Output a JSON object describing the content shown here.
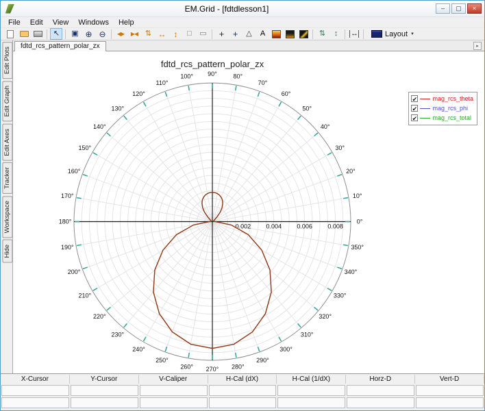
{
  "window": {
    "title": "EM.Grid - [fdtdlesson1]",
    "controls": [
      {
        "name": "minimize-button",
        "glyph": "–"
      },
      {
        "name": "maximize-button",
        "glyph": "▢"
      },
      {
        "name": "close-button",
        "glyph": "×",
        "close": true
      }
    ]
  },
  "menu": {
    "items": [
      "File",
      "Edit",
      "View",
      "Windows",
      "Help"
    ]
  },
  "toolbar": {
    "buttons": [
      {
        "type": "page",
        "name": "new-file-button"
      },
      {
        "type": "folder",
        "name": "open-file-button"
      },
      {
        "type": "printer",
        "name": "print-button"
      },
      {
        "type": "sep"
      },
      {
        "type": "glyph",
        "name": "select-cursor-button",
        "glyph": "↖",
        "color": "#222222",
        "size": 11,
        "active": true
      },
      {
        "type": "sep"
      },
      {
        "type": "glyph",
        "name": "zoom-window-button",
        "glyph": "▣",
        "color": "#1c2f6d",
        "size": 11
      },
      {
        "type": "glyph",
        "name": "zoom-in-button",
        "glyph": "⊕",
        "color": "#1c2f6d",
        "size": 12
      },
      {
        "type": "glyph",
        "name": "zoom-out-button",
        "glyph": "⊖",
        "color": "#1c2f6d",
        "size": 12
      },
      {
        "type": "sep"
      },
      {
        "type": "glyph",
        "name": "fit-width-button",
        "glyph": "◀▶",
        "color": "#d07800",
        "size": 8
      },
      {
        "type": "glyph",
        "name": "shrink-width-button",
        "glyph": "▶◀",
        "color": "#d07800",
        "size": 8
      },
      {
        "type": "glyph",
        "name": "fit-height-button",
        "glyph": "⇅",
        "color": "#d07800",
        "size": 11
      },
      {
        "type": "glyph",
        "name": "expand-horizontal-button",
        "glyph": "↔",
        "color": "#d07800",
        "size": 12
      },
      {
        "type": "glyph",
        "name": "expand-vertical-button",
        "glyph": "↕",
        "color": "#d07800",
        "size": 12
      },
      {
        "type": "glyph",
        "name": "box-select-button",
        "glyph": "□",
        "color": "#777777",
        "size": 11
      },
      {
        "type": "glyph",
        "name": "dashed-box-button",
        "glyph": "▭",
        "color": "#777777",
        "size": 11
      },
      {
        "type": "sep"
      },
      {
        "type": "glyph",
        "name": "crosshair-button",
        "glyph": "+",
        "color": "#222222",
        "size": 13
      },
      {
        "type": "glyph",
        "name": "add-cursor-button",
        "glyph": "+",
        "color": "#1c2f6d",
        "size": 13
      },
      {
        "type": "glyph",
        "name": "caliper-button",
        "glyph": "△",
        "color": "#333333",
        "size": 11
      },
      {
        "type": "glyph",
        "name": "text-tool-button",
        "glyph": "A",
        "color": "#000000",
        "size": 11
      },
      {
        "type": "grad1",
        "name": "colormap-hot-button"
      },
      {
        "type": "grad2",
        "name": "colormap-dark-button"
      },
      {
        "type": "grad3",
        "name": "colormap-contour-button"
      },
      {
        "type": "sep"
      },
      {
        "type": "glyph",
        "name": "shift-up-down-button",
        "glyph": "⇅",
        "color": "#2a7a4f",
        "size": 11
      },
      {
        "type": "glyph",
        "name": "stretch-vertical-button",
        "glyph": "↕",
        "color": "#2a7a4f",
        "size": 11
      },
      {
        "type": "sep"
      },
      {
        "type": "glyph",
        "name": "h-measure-button",
        "glyph": "↔",
        "color": "#333333",
        "size": 11,
        "bracket": true
      },
      {
        "type": "sep"
      },
      {
        "type": "layout",
        "name": "layout-button",
        "label": "Layout",
        "caret": "▼"
      }
    ]
  },
  "sidebar": {
    "tabs": [
      "Edit Plots",
      "Edit Graph",
      "Edit Axes",
      "Tracker",
      "Workspace",
      "Hide"
    ]
  },
  "tabs": {
    "active": "fdtd_rcs_pattern_polar_zx"
  },
  "legend": {
    "check_glyph": "✔",
    "items": [
      {
        "label": "mag_rcs_theta",
        "color": "#cc2020",
        "checked": true
      },
      {
        "label": "mag_rcs_phi",
        "color": "#5050cc",
        "checked": true
      },
      {
        "label": "mag_rcs_total",
        "color": "#2fa22f",
        "checked": true
      }
    ]
  },
  "status_bar": {
    "columns": [
      "X-Cursor",
      "Y-Cursor",
      "V-Caliper",
      "H-Cal (dX)",
      "H-Cal (1/dX)",
      "Horz-D",
      "Vert-D"
    ]
  },
  "chart_data": {
    "type": "polar",
    "title": "fdtd_rcs_pattern_polar_zx",
    "r_max": 0.009,
    "r_grid_step": 0.0005,
    "angle_step_deg": 10,
    "degree_suffix": "°",
    "grid_on": true,
    "grid_color": "#e4e4e4",
    "axis_color": "#1a1a1a",
    "tick_color": "#35a89b",
    "legend_position": "top-right",
    "angle_labels_deg": [
      0,
      10,
      20,
      30,
      40,
      50,
      60,
      70,
      80,
      90,
      100,
      110,
      120,
      130,
      140,
      150,
      160,
      170,
      180,
      190,
      200,
      210,
      220,
      230,
      240,
      250,
      260,
      270,
      280,
      290,
      300,
      310,
      320,
      330,
      340,
      350
    ],
    "r_tick_labels": [
      {
        "value": 0.002,
        "label": "0.002"
      },
      {
        "value": 0.004,
        "label": "0.004"
      },
      {
        "value": 0.006,
        "label": "0.006"
      },
      {
        "value": 0.008,
        "label": "0.008"
      }
    ],
    "series": [
      {
        "name": "mag_rcs_theta",
        "color": "#8e3512",
        "points_deg_r": [
          [
            180,
            0.0002
          ],
          [
            190,
            0.00125
          ],
          [
            200,
            0.00249
          ],
          [
            210,
            0.00371
          ],
          [
            220,
            0.00489
          ],
          [
            230,
            0.00597
          ],
          [
            240,
            0.0069
          ],
          [
            250,
            0.00762
          ],
          [
            260,
            0.00808
          ],
          [
            270,
            0.00823
          ],
          [
            280,
            0.00808
          ],
          [
            290,
            0.00762
          ],
          [
            300,
            0.0069
          ],
          [
            310,
            0.00597
          ],
          [
            320,
            0.00489
          ],
          [
            330,
            0.00371
          ],
          [
            340,
            0.00249
          ],
          [
            350,
            0.00125
          ],
          [
            0,
            0.0002
          ],
          [
            10,
            8e-05
          ],
          [
            20,
            8e-05
          ],
          [
            30,
            0.0001
          ],
          [
            40,
            0.0002
          ],
          [
            45,
            0.0004
          ],
          [
            50,
            0.0008
          ],
          [
            55,
            0.0011
          ],
          [
            60,
            0.00135
          ],
          [
            65,
            0.00155
          ],
          [
            70,
            0.00168
          ],
          [
            75,
            0.00178
          ],
          [
            80,
            0.00185
          ],
          [
            85,
            0.00189
          ],
          [
            90,
            0.0019
          ],
          [
            95,
            0.00189
          ],
          [
            100,
            0.00185
          ],
          [
            105,
            0.00178
          ],
          [
            110,
            0.00168
          ],
          [
            115,
            0.00155
          ],
          [
            120,
            0.00135
          ],
          [
            125,
            0.0011
          ],
          [
            130,
            0.0008
          ],
          [
            135,
            0.0004
          ],
          [
            140,
            0.0002
          ],
          [
            150,
            0.0001
          ],
          [
            160,
            8e-05
          ],
          [
            170,
            8e-05
          ]
        ]
      }
    ]
  }
}
